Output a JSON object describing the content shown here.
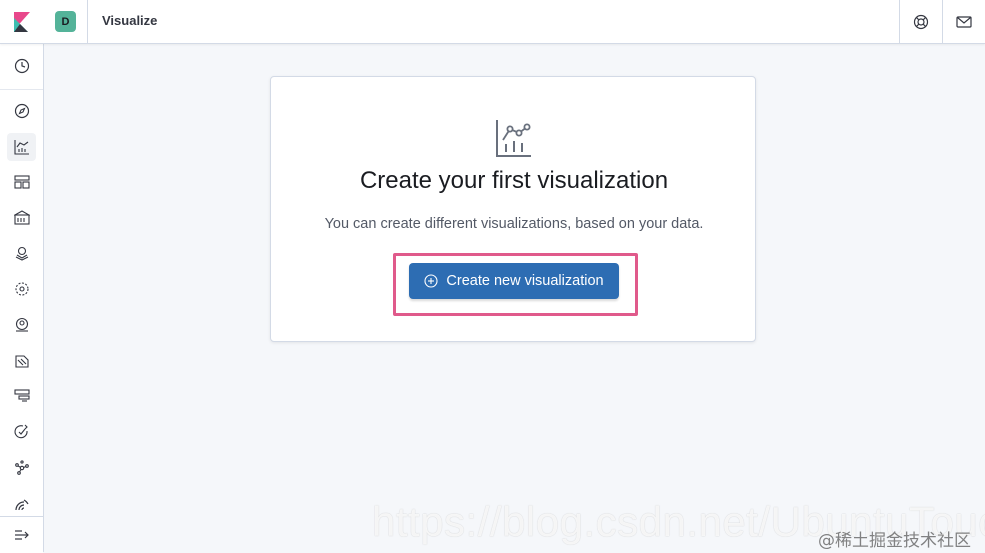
{
  "header": {
    "space_initial": "D",
    "breadcrumb": "Visualize",
    "icons": {
      "logo": "kibana-logo",
      "help": "help-icon",
      "mail": "mail-icon"
    }
  },
  "sidebar": {
    "items": [
      {
        "name": "recently-viewed",
        "icon": "clock-icon"
      },
      {
        "name": "discover",
        "icon": "compass-icon"
      },
      {
        "name": "visualize",
        "icon": "visualize-icon",
        "active": true
      },
      {
        "name": "dashboard",
        "icon": "dashboard-icon"
      },
      {
        "name": "canvas",
        "icon": "canvas-icon"
      },
      {
        "name": "maps",
        "icon": "maps-icon"
      },
      {
        "name": "machine-learning",
        "icon": "ml-icon"
      },
      {
        "name": "infrastructure",
        "icon": "infrastructure-icon"
      },
      {
        "name": "logs",
        "icon": "logs-icon"
      },
      {
        "name": "apm",
        "icon": "apm-icon"
      },
      {
        "name": "uptime",
        "icon": "uptime-icon"
      },
      {
        "name": "graph",
        "icon": "graph-icon"
      },
      {
        "name": "siem",
        "icon": "siem-icon"
      }
    ],
    "dock_toggle_icon": "dock-toggle-icon"
  },
  "main": {
    "title": "Create your first visualization",
    "description": "You can create different visualizations, based on your data.",
    "create_button_label": "Create new visualization"
  },
  "watermark": {
    "url": "https://blog.csdn.net/UbuntuTouch",
    "credit": "@稀土掘金技术社区"
  },
  "colors": {
    "accent": "#2d6db3",
    "highlight": "#e05a8b",
    "space_avatar": "#54b399"
  }
}
